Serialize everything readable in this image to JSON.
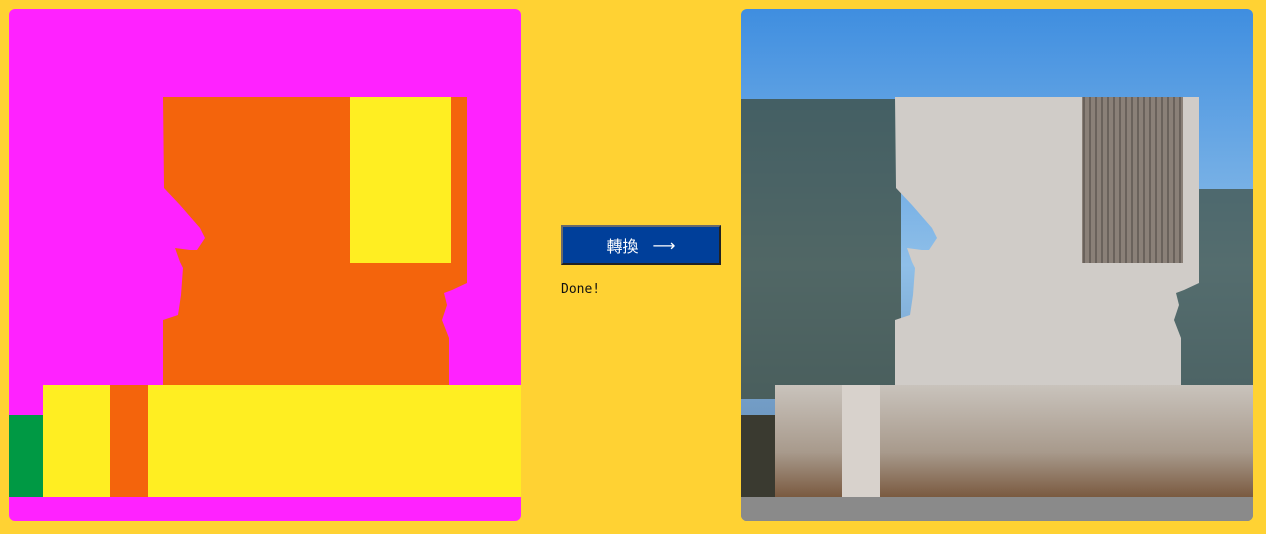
{
  "convert_button": {
    "label": "轉換",
    "arrow": "⟶"
  },
  "status_text": "Done!",
  "colors": {
    "background": "#ffd233",
    "button": "#003f9a",
    "magenta": "#ff22ff",
    "orange": "#f4640c",
    "yellow": "#ffee22",
    "green": "#009944"
  }
}
